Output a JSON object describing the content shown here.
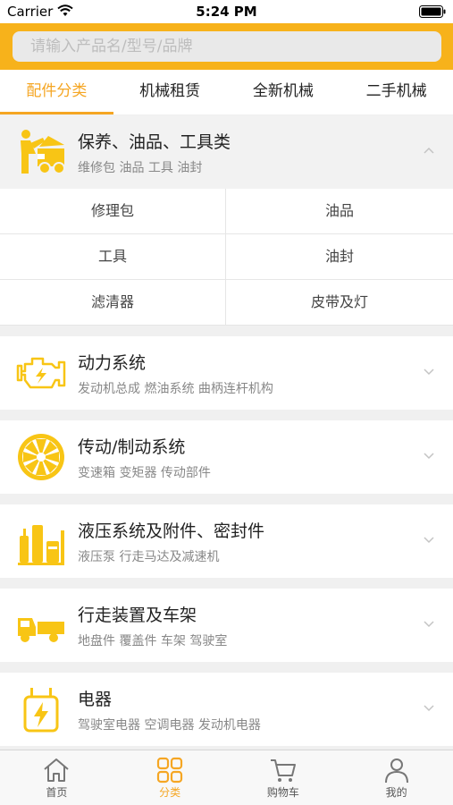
{
  "status_bar": {
    "carrier": "Carrier",
    "time": "5:24 PM"
  },
  "search": {
    "placeholder": "请输入产品名/型号/品牌"
  },
  "tabs": [
    {
      "label": "配件分类",
      "active": true
    },
    {
      "label": "机械租赁",
      "active": false
    },
    {
      "label": "全新机械",
      "active": false
    },
    {
      "label": "二手机械",
      "active": false
    }
  ],
  "categories": [
    {
      "title": "保养、油品、工具类",
      "subtitle": "维修包 油品 工具 油封",
      "icon": "mechanic-icon",
      "expanded": true
    },
    {
      "title": "动力系统",
      "subtitle": "发动机总成 燃油系统 曲柄连杆机构",
      "icon": "engine-icon",
      "expanded": false
    },
    {
      "title": "传动/制动系统",
      "subtitle": "变速箱 变矩器 传动部件",
      "icon": "fan-wheel-icon",
      "expanded": false
    },
    {
      "title": "液压系统及附件、密封件",
      "subtitle": "液压泵 行走马达及减速机",
      "icon": "hydraulic-tank-icon",
      "expanded": false
    },
    {
      "title": "行走装置及车架",
      "subtitle": "地盘件 覆盖件 车架 驾驶室",
      "icon": "truck-icon",
      "expanded": false
    },
    {
      "title": "电器",
      "subtitle": "驾驶室电器 空调电器 发动机电器",
      "icon": "electric-plug-icon",
      "expanded": false
    }
  ],
  "subcategories": [
    "修理包",
    "油品",
    "工具",
    "油封",
    "滤清器",
    "皮带及灯"
  ],
  "tabbar": [
    {
      "label": "首页",
      "icon": "home-icon",
      "active": false
    },
    {
      "label": "分类",
      "icon": "grid-icon",
      "active": true
    },
    {
      "label": "购物车",
      "icon": "cart-icon",
      "active": false
    },
    {
      "label": "我的",
      "icon": "user-icon",
      "active": false
    }
  ],
  "colors": {
    "accent": "#f5a623",
    "header": "#f7b21b",
    "icon_yellow": "#f8c515"
  }
}
